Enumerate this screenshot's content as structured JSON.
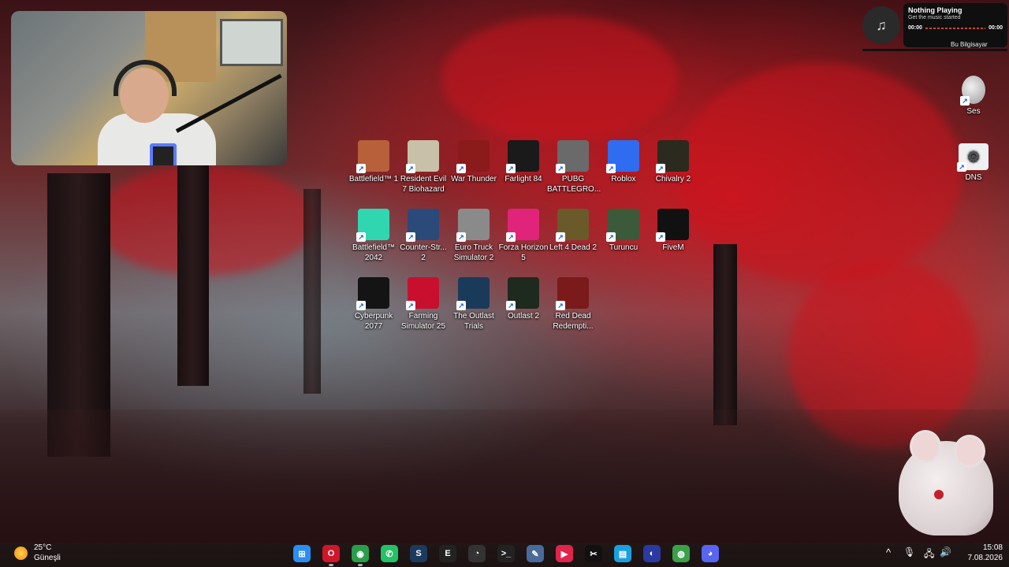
{
  "media": {
    "title": "Nothing Playing",
    "subtitle": "Get the music started",
    "time_start": "00:00",
    "time_end": "00:00",
    "peek_text": "Bu Bilgisayar",
    "icon": "music-note-icon"
  },
  "right_icons": [
    {
      "label": "Ses",
      "icon": "speaker-icon"
    },
    {
      "label": "DNS",
      "icon": "gears-icon"
    }
  ],
  "desktop_icons": [
    {
      "label": "Battlefield™ 1",
      "icon": "battlefield1-icon",
      "color": "#b8603a"
    },
    {
      "label": "Resident Evil 7 Biohazard",
      "icon": "resident-evil-icon",
      "color": "#c8c0a8"
    },
    {
      "label": "War Thunder",
      "icon": "war-thunder-icon",
      "color": "#8b1a1a"
    },
    {
      "label": "Farlight 84",
      "icon": "farlight-icon",
      "color": "#1a1a1a"
    },
    {
      "label": "PUBG BATTLEGRO...",
      "icon": "pubg-icon",
      "color": "#6a6a6a"
    },
    {
      "label": "Roblox",
      "icon": "roblox-icon",
      "color": "#2f6cf0"
    },
    {
      "label": "Chivalry 2",
      "icon": "chivalry-icon",
      "color": "#2a2a1e"
    },
    {
      "label": "Battlefield™ 2042",
      "icon": "battlefield2042-icon",
      "color": "#30d6b0"
    },
    {
      "label": "Counter-Str... 2",
      "icon": "counter-strike-icon",
      "color": "#2a4a7a"
    },
    {
      "label": "Euro Truck Simulator 2",
      "icon": "euro-truck-icon",
      "color": "#8a8a8a"
    },
    {
      "label": "Forza Horizon 5",
      "icon": "forza-icon",
      "color": "#e0247a"
    },
    {
      "label": "Left 4 Dead 2",
      "icon": "left4dead-icon",
      "color": "#6a5a2a"
    },
    {
      "label": "Turuncu",
      "icon": "turuncu-icon",
      "color": "#3a5a3a"
    },
    {
      "label": "FiveM",
      "icon": "fivem-icon",
      "color": "#111111"
    },
    {
      "label": "Cyberpunk 2077",
      "icon": "cyberpunk-icon",
      "color": "#141414"
    },
    {
      "label": "Farming Simulator 25",
      "icon": "farming-sim-icon",
      "color": "#c8102e"
    },
    {
      "label": "The Outlast Trials",
      "icon": "outlast-trials-icon",
      "color": "#1a3a5a"
    },
    {
      "label": "Outlast 2",
      "icon": "outlast2-icon",
      "color": "#1e2a1e"
    },
    {
      "label": "Red Dead Redempti...",
      "icon": "red-dead-icon",
      "color": "#7a1a1a"
    }
  ],
  "weather": {
    "temp": "25°C",
    "condition": "Güneşli",
    "icon": "sun-icon"
  },
  "taskbar_apps": [
    {
      "name": "start-button",
      "icon": "windows-icon",
      "color": "#2b8ef0",
      "glyph": "⊞"
    },
    {
      "name": "opera",
      "icon": "opera-icon",
      "color": "#d1162a",
      "glyph": "O"
    },
    {
      "name": "chrome",
      "icon": "chrome-icon",
      "color": "#2a9d4a",
      "glyph": "◉"
    },
    {
      "name": "whatsapp",
      "icon": "whatsapp-icon",
      "color": "#25c166",
      "glyph": "✆"
    },
    {
      "name": "steam",
      "icon": "steam-icon",
      "color": "#1b3a5c",
      "glyph": "S"
    },
    {
      "name": "epic-games",
      "icon": "epic-games-icon",
      "color": "#222222",
      "glyph": "E"
    },
    {
      "name": "rockstar-or-clock",
      "icon": "clock-app-icon",
      "color": "#333333",
      "glyph": "◔"
    },
    {
      "name": "terminal",
      "icon": "terminal-icon",
      "color": "#222222",
      "glyph": ">_"
    },
    {
      "name": "notepad",
      "icon": "notepad-icon",
      "color": "#4a6a9a",
      "glyph": "✎"
    },
    {
      "name": "media-player",
      "icon": "media-player-icon",
      "color": "#e0244a",
      "glyph": "▶"
    },
    {
      "name": "capcut",
      "icon": "capcut-icon",
      "color": "#111111",
      "glyph": "✂"
    },
    {
      "name": "files",
      "icon": "folder-icon",
      "color": "#1aa0e0",
      "glyph": "▤"
    },
    {
      "name": "browser-alt",
      "icon": "browser-icon",
      "color": "#2a3aa0",
      "glyph": "◐"
    },
    {
      "name": "earth-app",
      "icon": "globe-icon",
      "color": "#3aa04a",
      "glyph": "◍"
    },
    {
      "name": "discord",
      "icon": "discord-icon",
      "color": "#5865f2",
      "glyph": "◕"
    }
  ],
  "tray": {
    "chevron": "^",
    "mic": "🎙",
    "network": "🖧",
    "volume": "🔊"
  },
  "clock": {
    "time": "15:08",
    "date": "7.08.2026"
  }
}
